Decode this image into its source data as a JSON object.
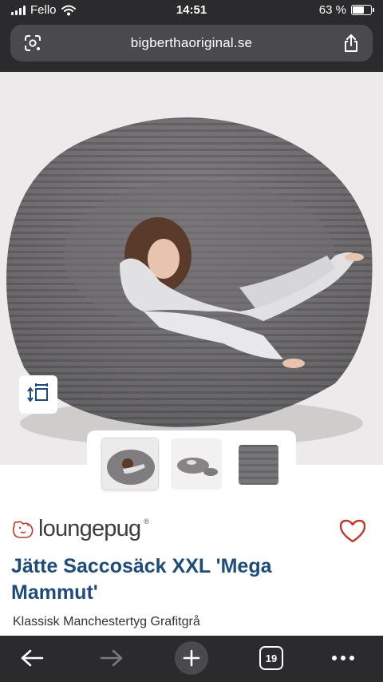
{
  "status_bar": {
    "carrier": "Fello",
    "time": "14:51",
    "battery": "63 %",
    "battery_level": 0.63
  },
  "browser": {
    "domain": "bigberthaoriginal.se",
    "lens_icon": "google-lens-icon",
    "share_icon": "share-icon"
  },
  "product": {
    "brand": "loungepug",
    "brand_mark": "®",
    "title": "Jätte Saccosäck XXL 'Mega Mammut'",
    "subtitle": "Klassisk Manchestertyg Grafitgrå",
    "gallery": {
      "dimensions_icon": "dimensions-icon",
      "thumbnails": [
        "bean-bag-with-woman",
        "bean-bag-with-footstool",
        "corduroy-fabric-swatch"
      ],
      "active_index": 0
    }
  },
  "toolbar": {
    "tab_count": "19",
    "back_icon": "back-arrow-icon",
    "forward_icon": "forward-arrow-icon",
    "new_tab_icon": "plus-icon",
    "more_icon": "more-icon"
  },
  "colors": {
    "title": "#1f4b7a",
    "heart": "#c0392b",
    "chrome": "#2b2b2d",
    "bean_bag": "#807d7f"
  }
}
